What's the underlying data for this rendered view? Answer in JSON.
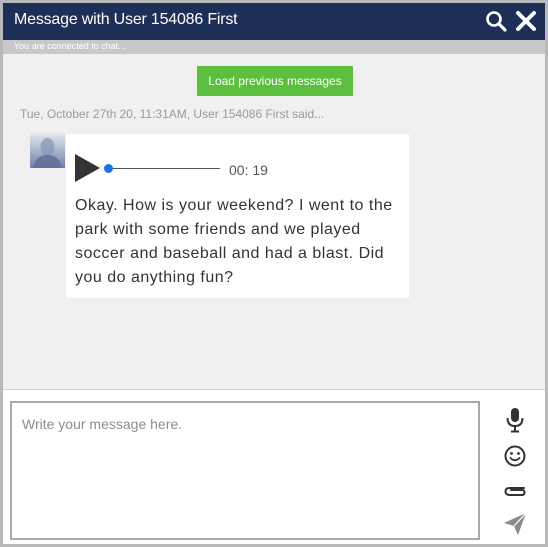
{
  "header": {
    "title": "Message with User 154086 First",
    "status": "You are connected to chat..."
  },
  "icons": {
    "search": "search-icon",
    "close": "close-icon",
    "play": "play-icon",
    "mic": "microphone-icon",
    "emoji": "emoji-icon",
    "attach": "paperclip-icon",
    "send": "send-icon"
  },
  "history": {
    "load_label": "Load previous messages"
  },
  "message": {
    "meta": "Tue, October 27th 20, 11:31AM, User 154086 First said...",
    "audio_duration": "00: 19",
    "audio_progress": 0,
    "text": "Okay. How is your weekend? I went to the park with some friends and we played soccer and baseball and had a blast. Did you do anything fun?"
  },
  "composer": {
    "placeholder": "Write your message here.",
    "value": ""
  },
  "colors": {
    "header_bg": "#1d2f57",
    "load_button": "#5cc03e",
    "audio_knob": "#1d72e8",
    "chat_bg": "#f0f0f0"
  }
}
